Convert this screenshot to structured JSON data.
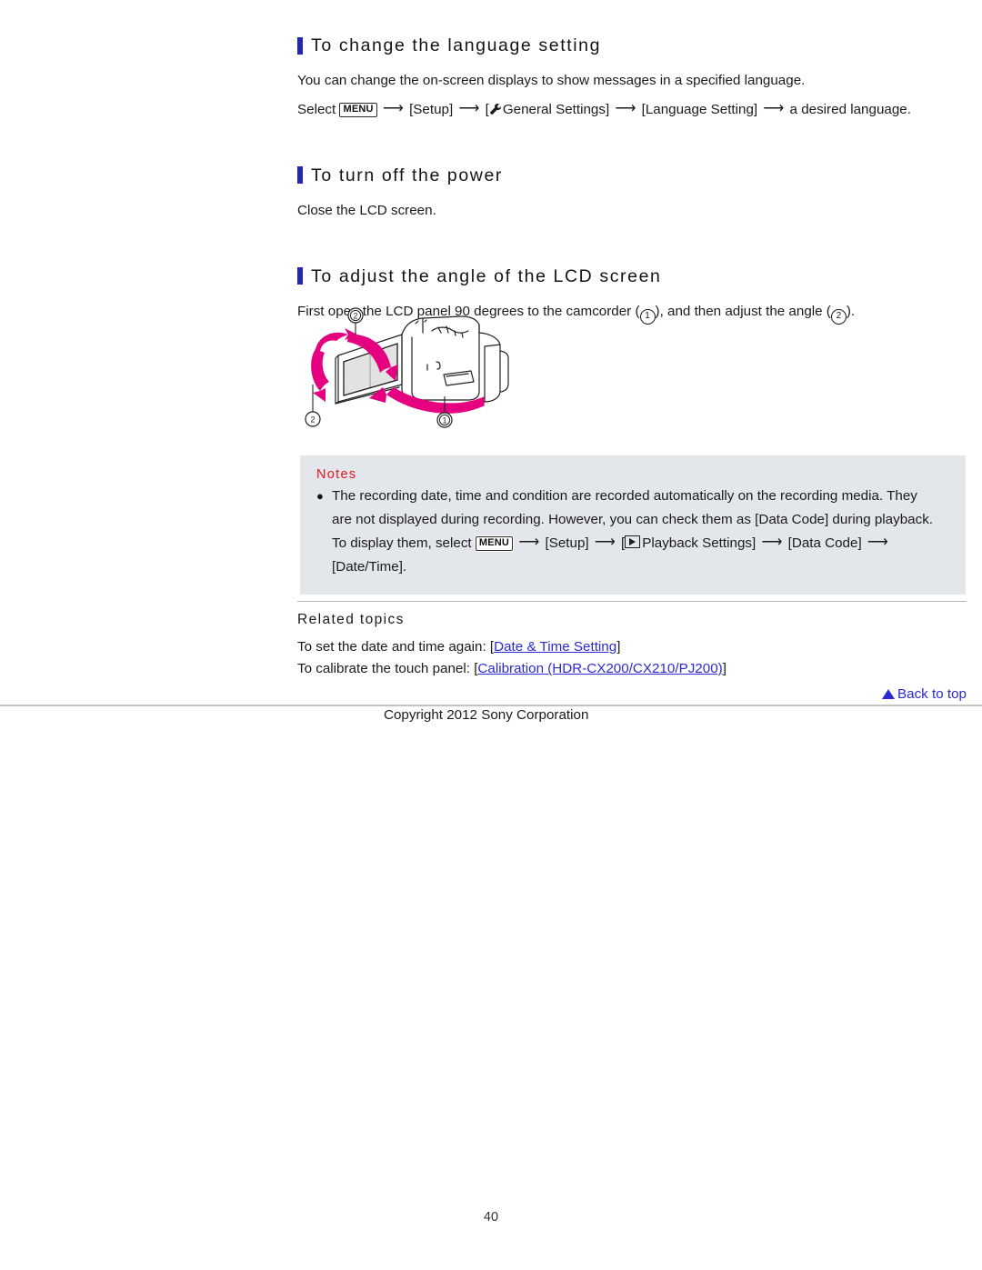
{
  "page": {
    "number": "40",
    "copyright": "Copyright 2012 Sony Corporation"
  },
  "sections": [
    {
      "heading": "To change the language setting",
      "body_line_1": "You can change the on-screen displays to show messages in a specified language.",
      "steps_prefix": "Select",
      "menu_label": "MENU",
      "step_setup": "[Setup]",
      "step_general_open": "[",
      "step_general": "General Settings]",
      "step_language": "[Language Setting]",
      "step_final": "a desired language.",
      "wrench_icon": "wrench-icon"
    },
    {
      "heading": "To turn off the power",
      "body_line_1": "Close the LCD screen."
    },
    {
      "heading": "To adjust the angle of the LCD screen",
      "body_prefix": "First open the LCD panel 90 degrees to the camcorder (",
      "callout_1": "1",
      "body_mid": "), and then adjust the angle (",
      "callout_2": "2",
      "body_suffix": ")."
    }
  ],
  "figure": {
    "name": "camcorder-lcd-angle-illustration",
    "callout_top": "2",
    "callout_left": "2",
    "callout_bottom": "1",
    "arrow_color": "#e4007f",
    "line_color": "#231f20"
  },
  "notes": {
    "title": "Notes",
    "bullet": "●",
    "line_1": "The recording date, time and condition are recorded automatically on the recording media. They",
    "line_2": "are not displayed during recording. However, you can check them as [Data Code] during playback.",
    "line_3_prefix": "To display them, select",
    "menu_label": "MENU",
    "step_setup": "[Setup]",
    "step_playback_open": "[",
    "step_playback": "Playback Settings]",
    "step_datacode": "[Data Code]",
    "line_4": "[Date/Time].",
    "playback_icon": "playback-icon",
    "title_color": "#e8141e",
    "bg_color": "#e3e6eb"
  },
  "related": {
    "title": "Related topics",
    "item_1_text": "To set the date and time again: [",
    "item_1_link": "Date & Time Setting",
    "item_1_close": "]",
    "item_2_text": "To calibrate the touch panel: [",
    "item_2_link": "Calibration (HDR-CX200/CX210/PJ200)",
    "item_2_close": "]",
    "back_to_top": "Back to top",
    "link_color": "#2a2ad0"
  }
}
